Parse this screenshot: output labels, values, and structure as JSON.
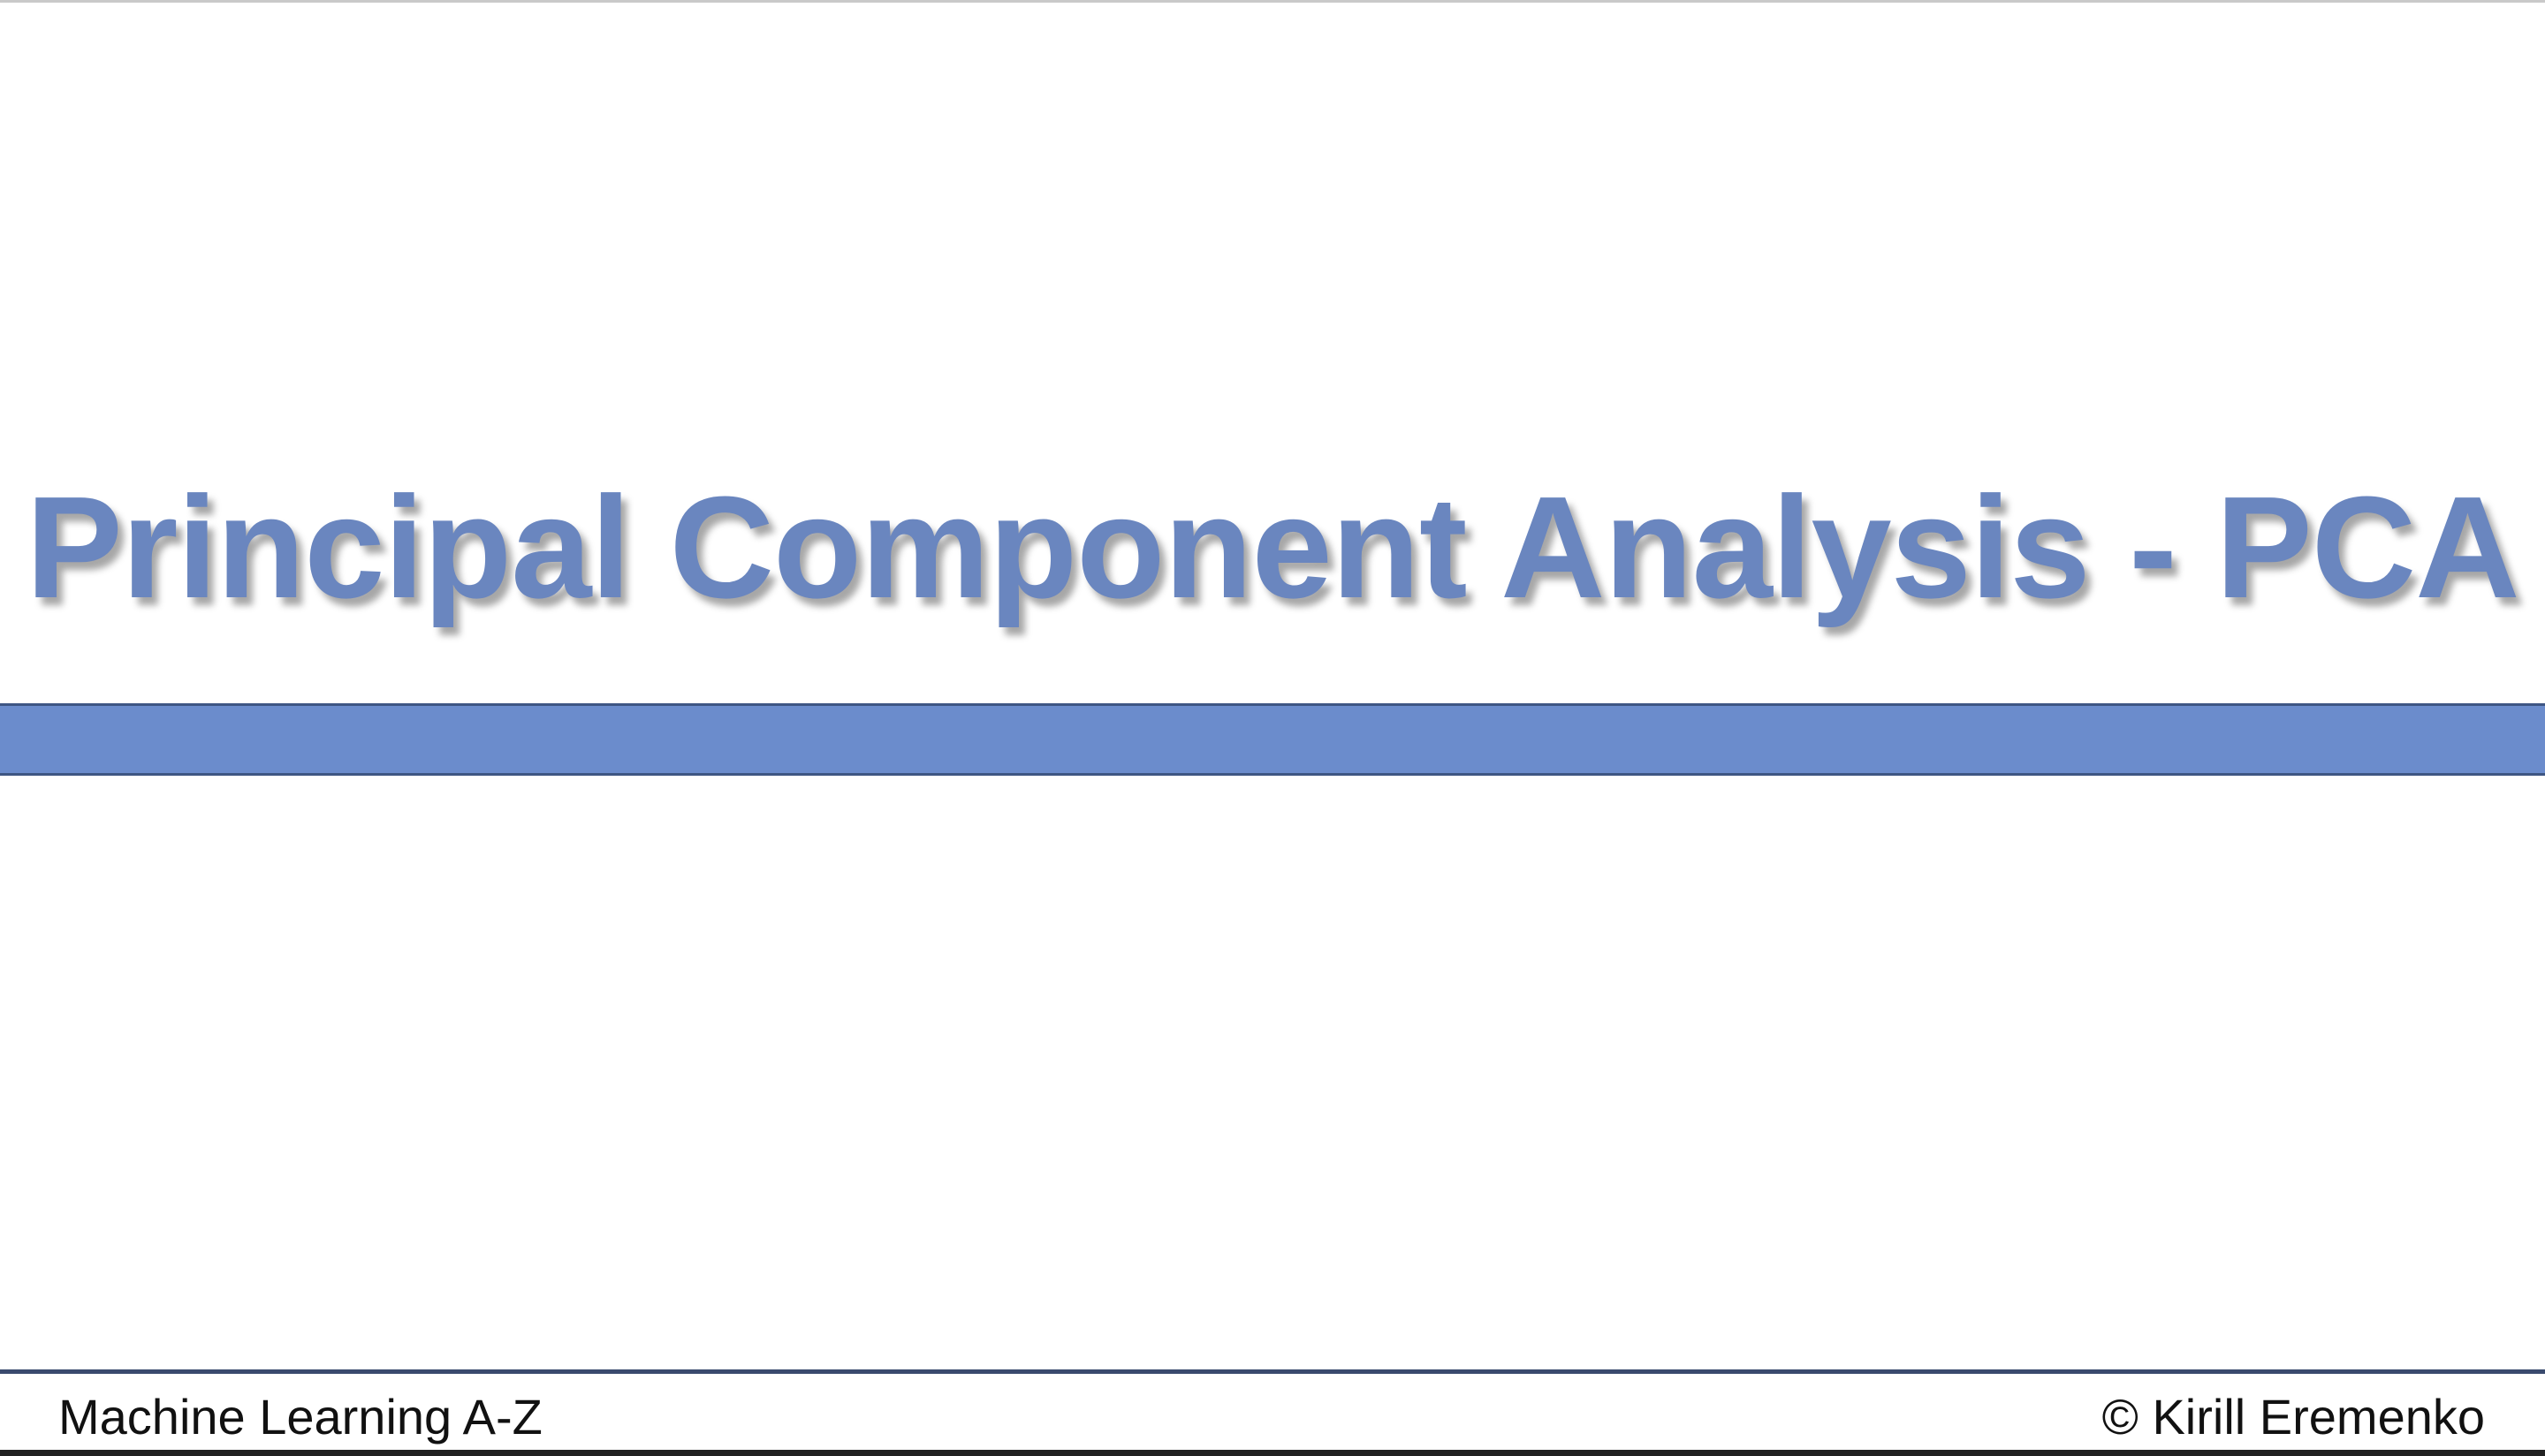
{
  "slide": {
    "title": "Principal Component Analysis - PCA",
    "footer_left": "Machine Learning A-Z",
    "footer_right": "© Kirill Eremenko"
  },
  "colors": {
    "title": "#6a86bf",
    "rule": "#6b8ccc",
    "rule_border": "#3e5683",
    "footer_line": "#3a4a6e",
    "footer_text": "#111111",
    "background": "#ffffff"
  }
}
